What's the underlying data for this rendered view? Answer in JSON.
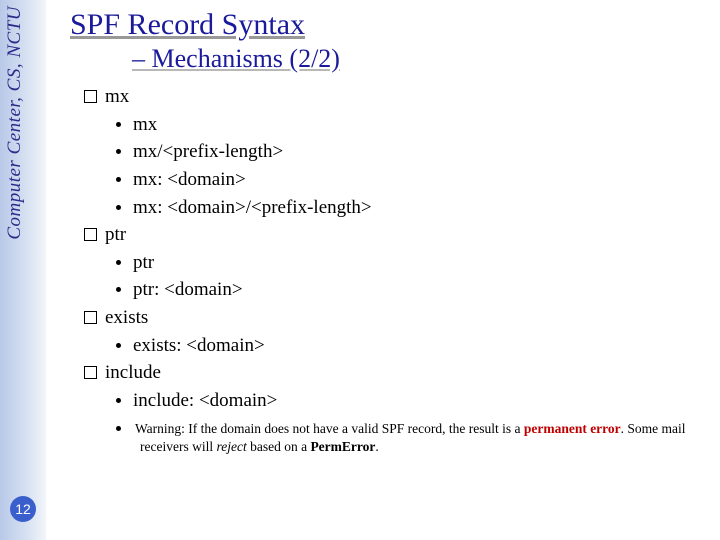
{
  "sidebar": {
    "org": "Computer Center, CS, NCTU"
  },
  "page_number": "12",
  "title": "SPF Record Syntax",
  "subtitle": "– Mechanisms (2/2)",
  "sections": [
    {
      "heading": "mx",
      "items": [
        "mx",
        "mx/<prefix-length>",
        "mx: <domain>",
        "mx: <domain>/<prefix-length>"
      ]
    },
    {
      "heading": "ptr",
      "items": [
        "ptr",
        "ptr: <domain>"
      ]
    },
    {
      "heading": "exists",
      "items": [
        "exists: <domain>"
      ]
    },
    {
      "heading": "include",
      "items": [
        "include: <domain>"
      ]
    }
  ],
  "warning": {
    "pre": "Warning: If the domain does not have a valid SPF record, the result is a ",
    "hl1": "permanent error",
    "mid": ". Some mail receivers will ",
    "hl2": "reject",
    "mid2": " based on a ",
    "hl3": "PermError",
    "post": "."
  }
}
